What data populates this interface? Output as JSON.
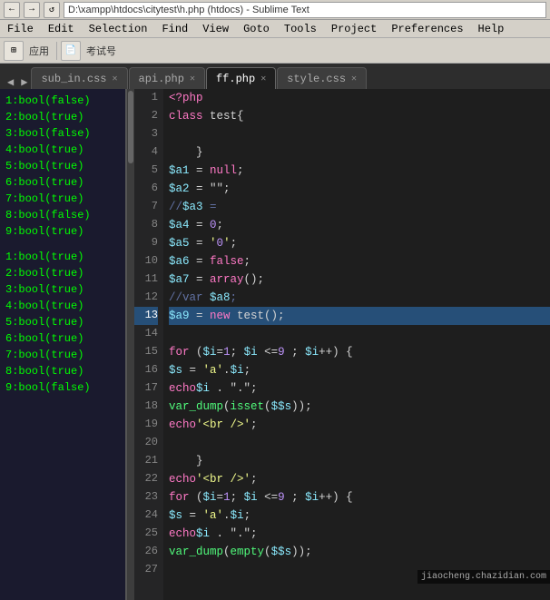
{
  "browser": {
    "url": "D:\\xampp\\htdocs\\citytest\\h.php (htdocs) - Sublime Text",
    "back_label": "←",
    "forward_label": "→",
    "refresh_label": "↺"
  },
  "menu": {
    "items": [
      "File",
      "Edit",
      "Selection",
      "Find",
      "View",
      "Goto",
      "Tools",
      "Project",
      "Preferences",
      "Help"
    ]
  },
  "tabs": [
    {
      "label": "sub_in.css",
      "active": false
    },
    {
      "label": "api.php",
      "active": false
    },
    {
      "label": "ff.php",
      "active": true
    },
    {
      "label": "style.css",
      "active": false
    }
  ],
  "left_output": {
    "section1": [
      "1:bool(false)",
      "2:bool(true)",
      "3:bool(false)",
      "4:bool(true)",
      "5:bool(true)",
      "6:bool(true)",
      "7:bool(true)",
      "8:bool(false)",
      "9:bool(true)"
    ],
    "section2": [
      "1:bool(true)",
      "2:bool(true)",
      "3:bool(true)",
      "4:bool(true)",
      "5:bool(true)",
      "6:bool(true)",
      "7:bool(true)",
      "8:bool(true)",
      "9:bool(false)"
    ]
  },
  "code": {
    "lines": [
      {
        "num": 1,
        "content": "<?php"
      },
      {
        "num": 2,
        "content": "    class test{"
      },
      {
        "num": 3,
        "content": ""
      },
      {
        "num": 4,
        "content": "    }"
      },
      {
        "num": 5,
        "content": "    $a1 = null;"
      },
      {
        "num": 6,
        "content": "    $a2 = \"\";"
      },
      {
        "num": 7,
        "content": "    //$a3 ="
      },
      {
        "num": 8,
        "content": "    $a4 = 0;"
      },
      {
        "num": 9,
        "content": "    $a5 = '0';"
      },
      {
        "num": 10,
        "content": "    $a6 = false;"
      },
      {
        "num": 11,
        "content": "    $a7 = array();"
      },
      {
        "num": 12,
        "content": "    //var $a8;"
      },
      {
        "num": 13,
        "content": "    $a9 = new test();",
        "highlight": true
      },
      {
        "num": 14,
        "content": ""
      },
      {
        "num": 15,
        "content": "    for ($i=1; $i <=9 ; $i++) {"
      },
      {
        "num": 16,
        "content": "        $s = 'a'.$i;"
      },
      {
        "num": 17,
        "content": "        echo $i . \".\";"
      },
      {
        "num": 18,
        "content": "        var_dump(isset($$s));"
      },
      {
        "num": 19,
        "content": "        echo '<br />';"
      },
      {
        "num": 20,
        "content": ""
      },
      {
        "num": 21,
        "content": "    }"
      },
      {
        "num": 22,
        "content": "    echo '<br />';"
      },
      {
        "num": 23,
        "content": "    for ($i=1; $i <=9 ; $i++) {"
      },
      {
        "num": 24,
        "content": "        $s = 'a'.$i;"
      },
      {
        "num": 25,
        "content": "        echo $i . \".\";"
      },
      {
        "num": 26,
        "content": "        var_dump(empty($$s));"
      },
      {
        "num": 27,
        "content": ""
      }
    ]
  },
  "watermark": {
    "text": "jiaocheng.chazidian.com"
  }
}
